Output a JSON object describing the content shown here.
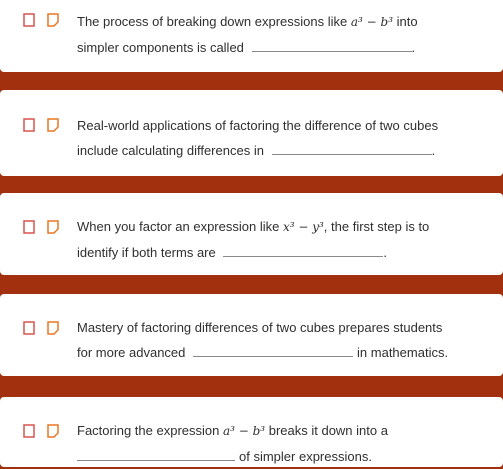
{
  "questions": [
    {
      "pre": "The process of breaking down expressions like ",
      "math": "a³ − b³",
      "mid": " into",
      "line2_pre": "simpler components is called",
      "post": "."
    },
    {
      "line1": "Real-world applications of factoring the difference of two cubes",
      "line2_pre": "include calculating differences in",
      "post": "."
    },
    {
      "pre": "When you factor an expression like ",
      "math": "x³ − y³",
      "mid": ", the first step is to",
      "line2_pre": "identify if both terms are",
      "post": "."
    },
    {
      "line1": "Mastery of factoring differences of two cubes prepares students",
      "line2_pre": "for more advanced",
      "post": "in mathematics."
    },
    {
      "pre": "Factoring the expression ",
      "math": "a³ − b³",
      "mid": " breaks it down into a",
      "post": "of simpler expressions."
    }
  ],
  "icon_colors": {
    "bookmark": "#d9534f",
    "flag": "#e87722"
  }
}
